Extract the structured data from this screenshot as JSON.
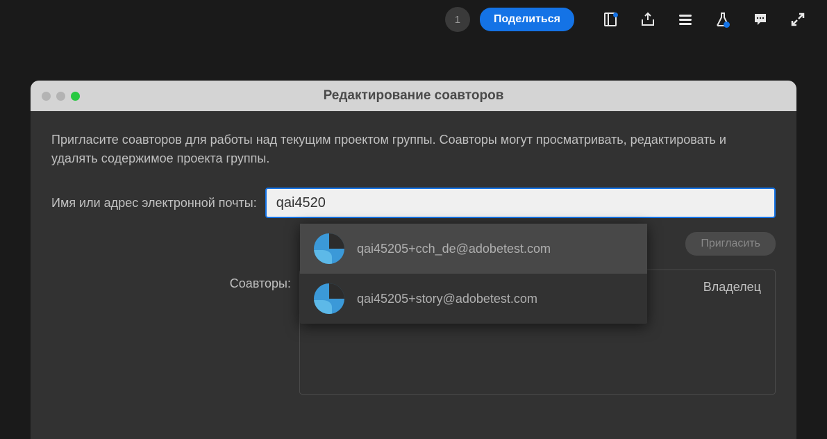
{
  "toolbar": {
    "badge_count": "1",
    "share_label": "Поделиться"
  },
  "modal": {
    "title": "Редактирование соавторов",
    "description": "Пригласите соавторов для работы над текущим проектом группы. Соавторы могут просматривать, редактировать и удалять содержимое проекта группы.",
    "input_label": "Имя или адрес электронной почты:",
    "input_value": "qai4520",
    "invite_label": "Пригласить",
    "collaborators_label": "Соавторы:",
    "owner_label": "Владелец"
  },
  "autocomplete": {
    "items": [
      {
        "email": "qai45205+cch_de@adobetest.com"
      },
      {
        "email": "qai45205+story@adobetest.com"
      }
    ]
  }
}
